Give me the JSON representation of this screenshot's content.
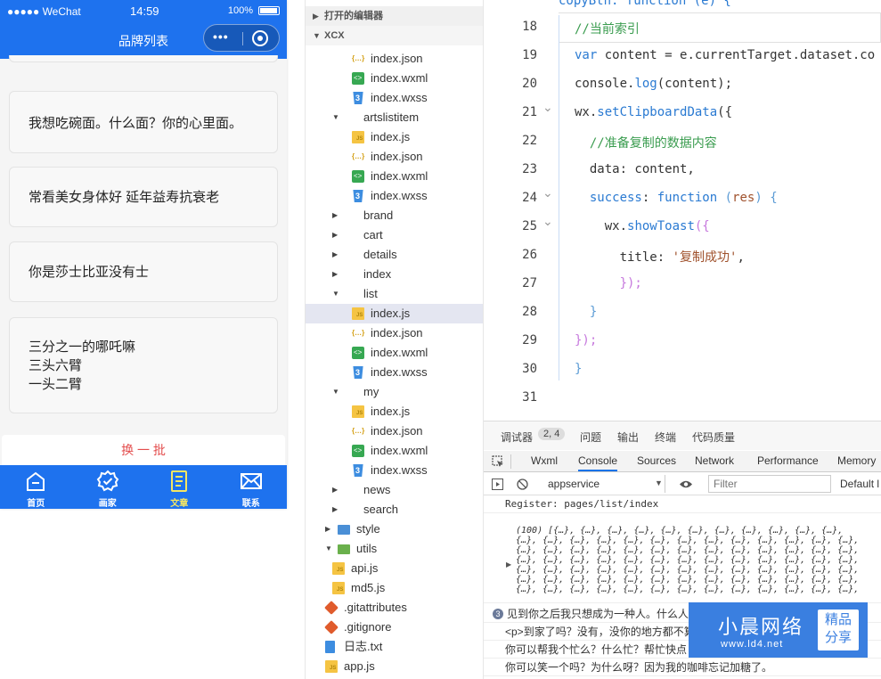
{
  "phone": {
    "status": {
      "carrier": "●●●●● WeChat",
      "time": "14:59",
      "battery": "100%"
    },
    "nav_title": "品牌列表",
    "capsule_dots": "•••",
    "cards": [
      {
        "lines": [
          "我想吃碗面。什么面？你的心里面。"
        ]
      },
      {
        "lines": [
          "常看美女身体好 延年益寿抗衰老"
        ]
      },
      {
        "lines": [
          "你是莎士比亚没有士"
        ]
      },
      {
        "lines": [
          "三分之一的哪吒嘛",
          "三头六臂",
          "一头二臂"
        ]
      }
    ],
    "swap_button": "换 一 批",
    "tabs": [
      {
        "label": "首页",
        "icon": "home-icon"
      },
      {
        "label": "画家",
        "icon": "badge-check-icon"
      },
      {
        "label": "文章",
        "icon": "document-icon",
        "active": true
      },
      {
        "label": "联系",
        "icon": "mail-icon"
      }
    ],
    "accent": "#1e72ee",
    "active_tab_color": "#f5e663"
  },
  "explorer": {
    "open_editors_header": "打开的编辑器",
    "project_header": "XCX",
    "rows": [
      {
        "name": "index.json",
        "type": "json",
        "depth": 3
      },
      {
        "name": "index.wxml",
        "type": "wxml",
        "depth": 3
      },
      {
        "name": "index.wxss",
        "type": "wxss",
        "depth": 3
      },
      {
        "name": "artslistitem",
        "type": "folder-open",
        "depth": 2
      },
      {
        "name": "index.js",
        "type": "js",
        "depth": 3
      },
      {
        "name": "index.json",
        "type": "json",
        "depth": 3
      },
      {
        "name": "index.wxml",
        "type": "wxml",
        "depth": 3
      },
      {
        "name": "index.wxss",
        "type": "wxss",
        "depth": 3
      },
      {
        "name": "brand",
        "type": "folder",
        "depth": 2
      },
      {
        "name": "cart",
        "type": "folder",
        "depth": 2
      },
      {
        "name": "details",
        "type": "folder",
        "depth": 2
      },
      {
        "name": "index",
        "type": "folder",
        "depth": 2
      },
      {
        "name": "list",
        "type": "folder-open",
        "depth": 2
      },
      {
        "name": "index.js",
        "type": "js",
        "depth": 3,
        "selected": true
      },
      {
        "name": "index.json",
        "type": "json",
        "depth": 3
      },
      {
        "name": "index.wxml",
        "type": "wxml",
        "depth": 3
      },
      {
        "name": "index.wxss",
        "type": "wxss",
        "depth": 3
      },
      {
        "name": "my",
        "type": "folder-open",
        "depth": 2
      },
      {
        "name": "index.js",
        "type": "js",
        "depth": 3
      },
      {
        "name": "index.json",
        "type": "json",
        "depth": 3
      },
      {
        "name": "index.wxml",
        "type": "wxml",
        "depth": 3
      },
      {
        "name": "index.wxss",
        "type": "wxss",
        "depth": 3
      },
      {
        "name": "news",
        "type": "folder",
        "depth": 2
      },
      {
        "name": "search",
        "type": "folder",
        "depth": 2
      },
      {
        "name": "style",
        "type": "folder-blue",
        "depth": 1
      },
      {
        "name": "utils",
        "type": "folder-green-open",
        "depth": 1
      },
      {
        "name": "api.js",
        "type": "js",
        "depth": 2
      },
      {
        "name": "md5.js",
        "type": "js",
        "depth": 2
      },
      {
        "name": ".gitattributes",
        "type": "git",
        "depth": 1
      },
      {
        "name": ".gitignore",
        "type": "git",
        "depth": 1
      },
      {
        "name": "日志.txt",
        "type": "txt",
        "depth": 1
      },
      {
        "name": "app.js",
        "type": "js",
        "depth": 1
      }
    ]
  },
  "editor": {
    "partial_top_line": "copyBtn: function (e) {",
    "lines": [
      {
        "num": "18",
        "html": "<span class='c'>//当前索引</span>"
      },
      {
        "num": "19",
        "html": "<span class='k'>var</span> content = e.currentTarget.dataset.co"
      },
      {
        "num": "20",
        "html": "console.<span class='f'>log</span>(content);"
      },
      {
        "num": "21",
        "html": "wx.<span class='f'>setClipboardData</span>({",
        "fold": true
      },
      {
        "num": "22",
        "html": "  <span class='c'>//准备复制的数据内容</span>"
      },
      {
        "num": "23",
        "html": "  data: content,"
      },
      {
        "num": "24",
        "html": "  <span class='k'>success</span>: <span class='k'>function</span> <span class='p'>(</span><span class='s'>res</span><span class='p'>)</span> <span class='p'>{</span>",
        "fold": true
      },
      {
        "num": "25",
        "html": "    wx.<span class='f'>showToast</span><span class='pa'>({</span>",
        "fold": true
      },
      {
        "num": "26",
        "html": "      title: <span class='s'>'复制成功'</span>,"
      },
      {
        "num": "27",
        "html": "      <span class='pa'>});</span>"
      },
      {
        "num": "28",
        "html": "  <span class='p'>}</span>"
      },
      {
        "num": "29",
        "html": "<span class='pa'>});</span>"
      },
      {
        "num": "30",
        "html": "<span class='p'>}</span>"
      },
      {
        "num": "31",
        "html": ""
      }
    ]
  },
  "panel": {
    "tabs": [
      "调试器",
      "问题",
      "输出",
      "终端",
      "代码质量"
    ],
    "debugger_badge": "2, 4",
    "devtools_tabs": [
      "Wxml",
      "Console",
      "Sources",
      "Network",
      "Performance",
      "Memory"
    ],
    "active_devtool": "Console",
    "context_select": "appservice",
    "filter_placeholder": "Filter",
    "levels": "Default l",
    "console": {
      "register": "Register: pages/list/index",
      "array_head": "(100) [{…}, {…}, {…}, {…}, {…}, {…}, {…}, {…}, {…}, {…}, {…},",
      "array_row": "{…}, {…}, {…}, {…}, {…}, {…}, {…}, {…}, {…}, {…}, {…}, {…}, {…},",
      "log_count": "3",
      "logs": [
        "见到你之后我只想成为一种人。什么人",
        "<p>到家了吗？没有，没你的地方都不算",
        "你可以帮我个忙么？什么忙？帮忙快点",
        "你可以笑一个吗？为什么呀？因为我的咖啡忘记加糖了。"
      ]
    }
  },
  "watermark": {
    "name": "小晨网络",
    "url": "www.ld4.net",
    "stamp_line1": "精品",
    "stamp_line2": "分享"
  }
}
